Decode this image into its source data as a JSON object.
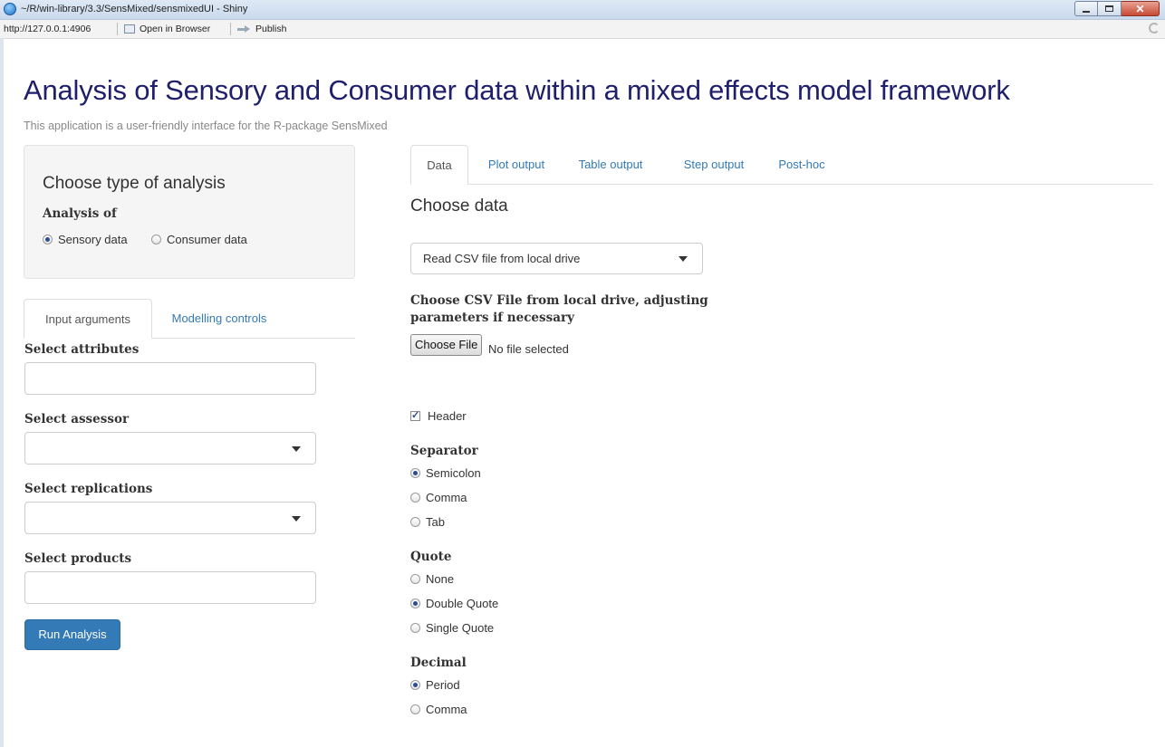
{
  "window": {
    "title": "~/R/win-library/3.3/SensMixed/sensmixedUI - Shiny"
  },
  "toolbar": {
    "url": "http://127.0.0.1:4906",
    "open_in_browser": "Open in Browser",
    "publish": "Publish"
  },
  "page": {
    "title": "Analysis of Sensory and Consumer data within a mixed effects model framework",
    "subtitle": "This application is a user-friendly interface for the R-package SensMixed"
  },
  "analysis_panel": {
    "title": "Choose type of analysis",
    "label": "Analysis of",
    "options": [
      "Sensory data",
      "Consumer data"
    ],
    "selected": "Sensory data"
  },
  "left_tabs": [
    "Input arguments",
    "Modelling controls"
  ],
  "left_active_tab": "Input arguments",
  "inputs": {
    "attributes_label": "Select attributes",
    "assessor_label": "Select assessor",
    "replications_label": "Select replications",
    "products_label": "Select products",
    "run_button": "Run Analysis"
  },
  "main_tabs": [
    "Data",
    "Plot output",
    "Table output",
    "Step output",
    "Post-hoc"
  ],
  "main_active_tab": "Data",
  "data_panel": {
    "heading": "Choose data",
    "source_select": "Read CSV file from local drive",
    "csv_label": "Choose CSV File from local drive, adjusting parameters if necessary",
    "file_button": "Choose File",
    "file_status": "No file selected",
    "header_label": "Header",
    "header_checked": true,
    "separator_label": "Separator",
    "separator_options": [
      "Semicolon",
      "Comma",
      "Tab"
    ],
    "separator_selected": "Semicolon",
    "quote_label": "Quote",
    "quote_options": [
      "None",
      "Double Quote",
      "Single Quote"
    ],
    "quote_selected": "Double Quote",
    "decimal_label": "Decimal",
    "decimal_options": [
      "Period",
      "Comma"
    ],
    "decimal_selected": "Period"
  }
}
